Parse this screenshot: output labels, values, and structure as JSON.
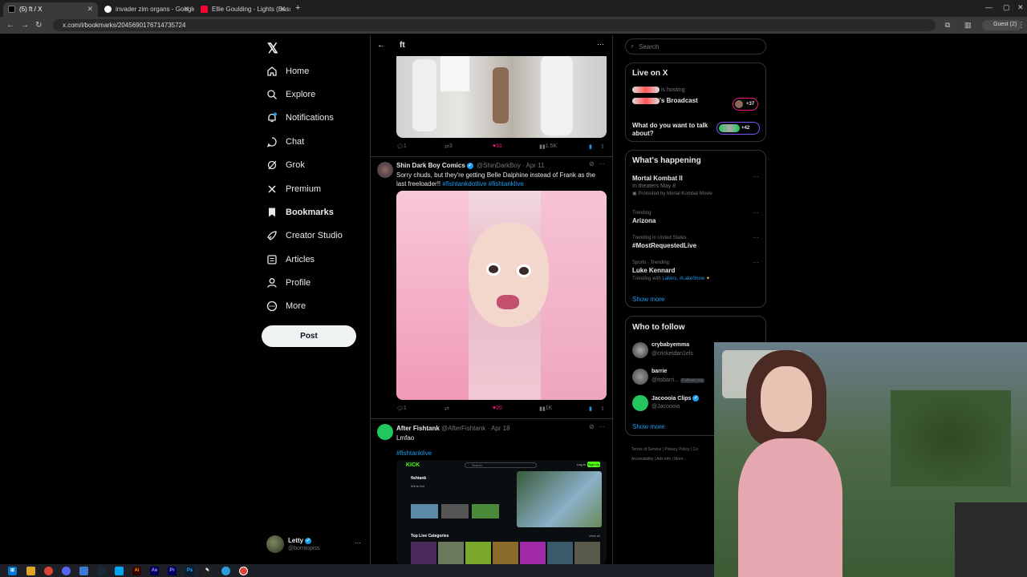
{
  "browser": {
    "tabs": [
      {
        "title": "(5) ft / X",
        "active": true
      },
      {
        "title": "invader zim organs - Google S",
        "active": false
      },
      {
        "title": "Ellie Goulding - Lights (Bassno",
        "active": false
      }
    ],
    "url": "x.com/i/bookmarks/2045690176714735724",
    "profile_label": "Guest (2)"
  },
  "sidebar": {
    "items": [
      {
        "label": "Home",
        "icon": "home-icon"
      },
      {
        "label": "Explore",
        "icon": "search-icon"
      },
      {
        "label": "Notifications",
        "icon": "bell-icon"
      },
      {
        "label": "Chat",
        "icon": "chat-icon"
      },
      {
        "label": "Grok",
        "icon": "grok-icon"
      },
      {
        "label": "Premium",
        "icon": "x-premium-icon"
      },
      {
        "label": "Bookmarks",
        "icon": "bookmark-icon"
      },
      {
        "label": "Creator Studio",
        "icon": "rocket-icon"
      },
      {
        "label": "Articles",
        "icon": "article-icon"
      },
      {
        "label": "Profile",
        "icon": "person-icon"
      },
      {
        "label": "More",
        "icon": "more-circle-icon"
      }
    ],
    "post_label": "Post",
    "account": {
      "name": "Letty",
      "handle": "@borntopiss"
    }
  },
  "timeline": {
    "title": "ft",
    "posts": [
      {
        "actions": {
          "replies": "1",
          "reposts": "3",
          "likes": "31",
          "views": "1.5K"
        }
      },
      {
        "author": "Shin Dark Boy Comics",
        "handle": "@ShinDarkBoy · Apr 11",
        "text": "Sorry chuds, but they're getting Belle Dalphine instead of Frank as the last freeloader!!",
        "hashtags": [
          "#fishtankdotlive",
          "#fishtanklive"
        ],
        "actions": {
          "replies": "1",
          "reposts": "",
          "likes": "20",
          "views": "1K"
        }
      },
      {
        "author": "After Fishtank",
        "handle": "@AfterFishtank · Apr 18",
        "text": "Lmfao",
        "hashtag": "#fishtanklive",
        "embed": {
          "brand": "KICK",
          "search": "Search",
          "login": "Log in",
          "signup": "Sign Up",
          "channel": "fishtank",
          "channel_sub": "We're live",
          "section": "Top Live Categories",
          "view_all": "View all"
        }
      }
    ]
  },
  "right": {
    "search_placeholder": "Search",
    "live": {
      "title": "Live on X",
      "hosting": "is hosting",
      "broadcast": "'s Broadcast",
      "count1": "+37",
      "question": "What do you want to talk about?",
      "count2": "+42"
    },
    "happening": {
      "title": "What's happening",
      "trends": [
        {
          "name": "Mortal Kombat II",
          "sub1": "In theaters May 8",
          "sub2": "Promoted by Mortal Kombat Movie"
        },
        {
          "context": "Trending",
          "name": "Arizona"
        },
        {
          "context": "Trending in United States",
          "name": "#MostRequestedLive"
        },
        {
          "context": "Sports · Trending",
          "name": "Luke Kennard",
          "sub1": "Trending with",
          "sub_tags": "Lakers, #LakeShow"
        }
      ],
      "show_more": "Show more"
    },
    "follow": {
      "title": "Who to follow",
      "users": [
        {
          "name": "crybabyemma",
          "handle": "@cricketdan1els"
        },
        {
          "name": "barrie",
          "handle": "@itsbarri...",
          "badge": "Follows you"
        },
        {
          "name": "Jacoooia Clips",
          "handle": "@Jacoooia"
        }
      ],
      "show_more": "Show more"
    },
    "footer": [
      "Terms of Service",
      "Privacy Policy",
      "Co",
      "Accessibility",
      "Ads info",
      "More ..."
    ]
  },
  "taskbar": {
    "apps": [
      "windows-icon",
      "explorer-icon",
      "chrome-icon",
      "discord-icon",
      "steam-icon",
      "app-icon",
      "illustrator-icon",
      "after-effects-icon",
      "premiere-icon",
      "photoshop-icon",
      "pen-icon",
      "app2-icon",
      "chrome2-icon"
    ]
  }
}
